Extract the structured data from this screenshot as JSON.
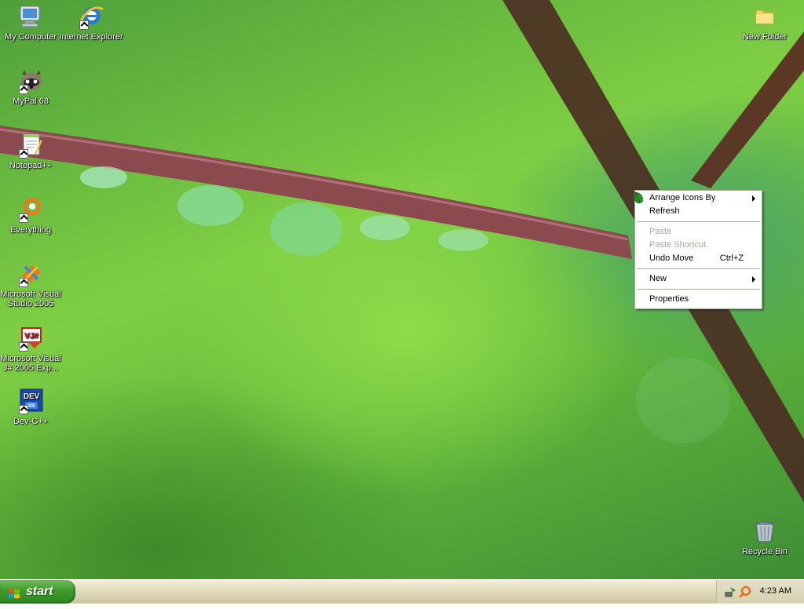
{
  "desktop": {
    "icons": [
      {
        "label": "My Computer"
      },
      {
        "label": "Internet Explorer"
      },
      {
        "label": "MyPal 68"
      },
      {
        "label": "Notepad++"
      },
      {
        "label": "Everything"
      },
      {
        "label": "Microsoft Visual Studio 2005"
      },
      {
        "label": "Microsoft Visual J# 2005 Exp..."
      },
      {
        "label": "Dev-C++"
      },
      {
        "label": "New Folder"
      },
      {
        "label": "Recycle Bin"
      }
    ]
  },
  "context_menu": {
    "items": [
      {
        "label": "Arrange Icons By",
        "submenu": true,
        "disabled": false
      },
      {
        "label": "Refresh",
        "submenu": false,
        "disabled": false
      },
      {
        "label": "Paste",
        "submenu": false,
        "disabled": true
      },
      {
        "label": "Paste Shortcut",
        "submenu": false,
        "disabled": true
      },
      {
        "label": "Undo Move",
        "shortcut": "Ctrl+Z",
        "submenu": false,
        "disabled": false
      },
      {
        "label": "New",
        "submenu": true,
        "disabled": false
      },
      {
        "label": "Properties",
        "submenu": false,
        "disabled": false
      }
    ]
  },
  "taskbar": {
    "start_label": "start",
    "clock": "4:23 AM"
  }
}
